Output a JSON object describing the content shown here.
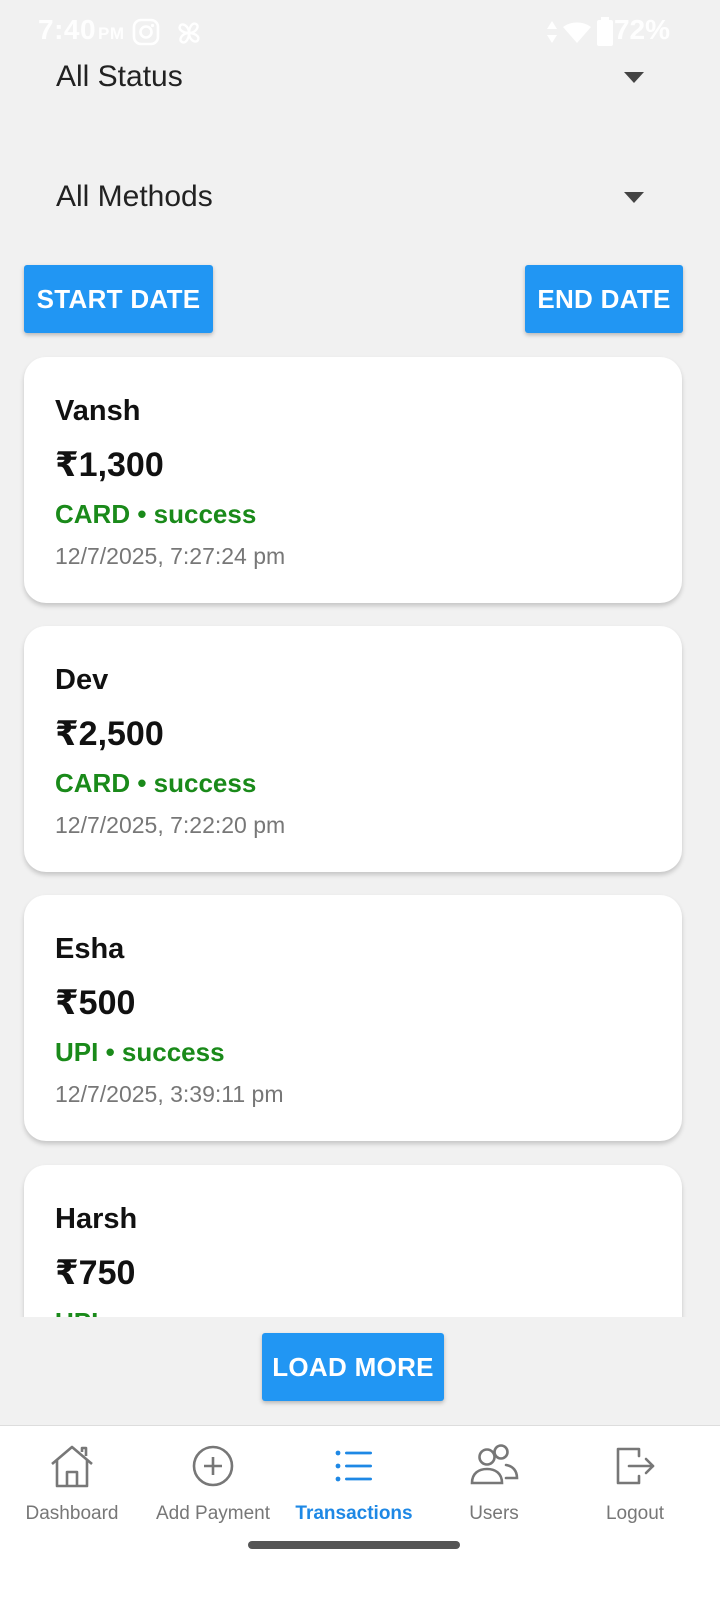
{
  "status_bar": {
    "time": "7:40",
    "ampm": "PM",
    "battery": "72%"
  },
  "filters": {
    "status": "All Status",
    "method": "All Methods"
  },
  "buttons": {
    "start_date": "START DATE",
    "end_date": "END DATE",
    "load_more": "LOAD MORE"
  },
  "transactions": [
    {
      "name": "Vansh",
      "amount": "₹1,300",
      "meta": "CARD • success",
      "time": "12/7/2025, 7:27:24 pm"
    },
    {
      "name": "Dev",
      "amount": "₹2,500",
      "meta": "CARD • success",
      "time": "12/7/2025, 7:22:20 pm"
    },
    {
      "name": "Esha",
      "amount": "₹500",
      "meta": "UPI • success",
      "time": "12/7/2025, 3:39:11 pm"
    },
    {
      "name": "Harsh",
      "amount": "₹750",
      "meta": "UPI • success",
      "time": ""
    }
  ],
  "nav": [
    {
      "label": "Dashboard",
      "icon": "home-icon"
    },
    {
      "label": "Add Payment",
      "icon": "plus-circle-icon"
    },
    {
      "label": "Transactions",
      "icon": "list-icon"
    },
    {
      "label": "Users",
      "icon": "users-icon"
    },
    {
      "label": "Logout",
      "icon": "logout-icon"
    }
  ],
  "colors": {
    "primary": "#2196f3",
    "active_nav": "#1e88e5",
    "success": "#1a8a1a",
    "background": "#f1f1f1"
  }
}
